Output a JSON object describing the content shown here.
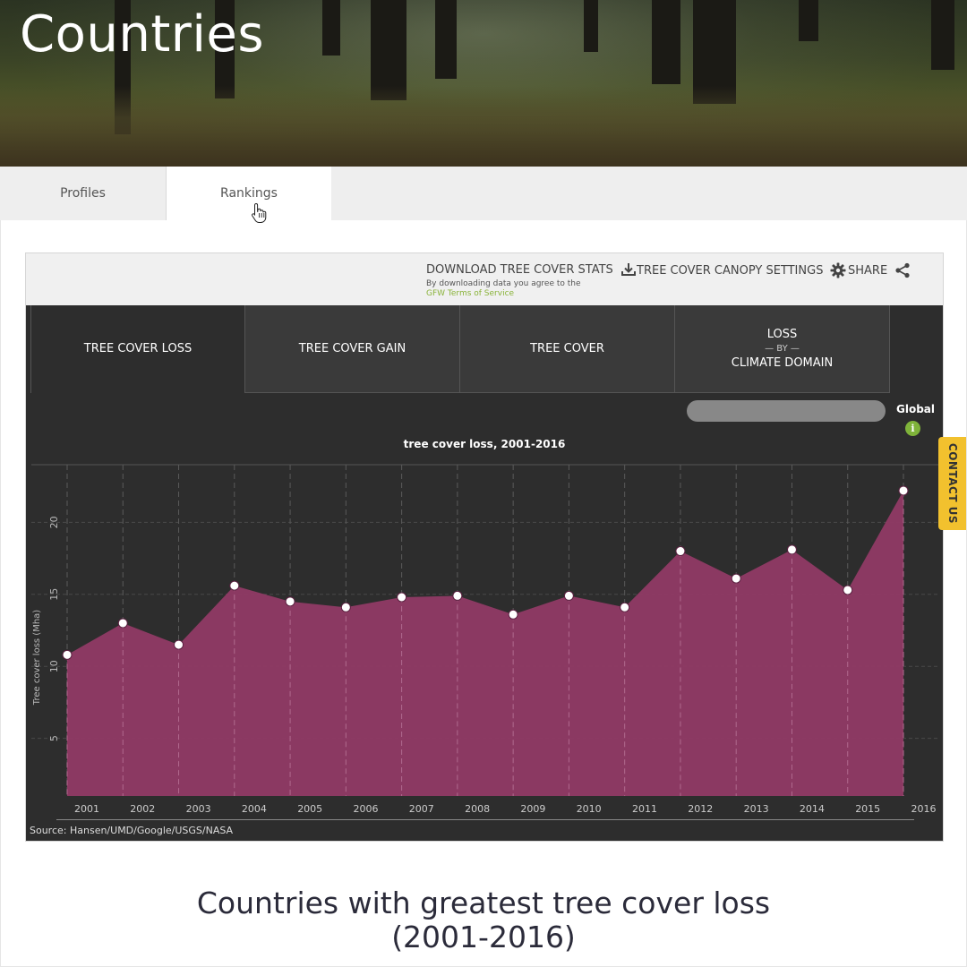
{
  "header": {
    "title": "Countries"
  },
  "tabs": [
    {
      "label": "Profiles"
    },
    {
      "label": "Rankings"
    }
  ],
  "toolbar": {
    "download_label": "DOWNLOAD TREE COVER STATS",
    "download_note": "By downloading data you agree to the",
    "terms_link": "GFW Terms of Service",
    "canopy_label": "TREE COVER CANOPY SETTINGS",
    "share_label": "SHARE"
  },
  "subtabs": [
    {
      "label": "TREE COVER LOSS"
    },
    {
      "label": "TREE COVER GAIN"
    },
    {
      "label": "TREE COVER"
    },
    {
      "line1": "LOSS",
      "line2": "— BY —",
      "line3": "CLIMATE DOMAIN"
    }
  ],
  "region": {
    "label": "Global"
  },
  "icons": {
    "download": "download-icon",
    "gear": "gear-icon",
    "share": "share-icon",
    "info": "info-icon",
    "cursor": "hand-pointer-icon"
  },
  "colors": {
    "area_fill": "#8e3a64",
    "panel_bg": "#2d2d2d",
    "accent_green": "#7fb33a",
    "contact_bg": "#f2c12e"
  },
  "chart_data": {
    "type": "area",
    "title": "tree cover loss, 2001-2016",
    "ylabel": "Tree cover loss (Mha)",
    "x": [
      "2001",
      "2002",
      "2003",
      "2004",
      "2005",
      "2006",
      "2007",
      "2008",
      "2009",
      "2010",
      "2011",
      "2012",
      "2013",
      "2014",
      "2015",
      "2016"
    ],
    "x_ticks": [
      "2001",
      "2002",
      "2003",
      "2004",
      "2005",
      "2006",
      "2007",
      "2008",
      "2009",
      "2010",
      "2011",
      "2012",
      "2013",
      "2014",
      "2015",
      "2016"
    ],
    "values": [
      10.8,
      13.0,
      11.5,
      15.6,
      14.5,
      14.1,
      14.8,
      14.9,
      13.6,
      14.9,
      14.1,
      18.0,
      16.1,
      18.1,
      15.3,
      22.2
    ],
    "y_ticks": [
      5,
      10,
      15,
      20
    ],
    "ylim": [
      1,
      24
    ],
    "grid": true
  },
  "source": "Source: Hansen/UMD/Google/USGS/NASA",
  "contact": {
    "label": "CONTACT US"
  },
  "caption": {
    "line1": "Countries with greatest tree cover loss",
    "line2": "(2001-2016)"
  }
}
